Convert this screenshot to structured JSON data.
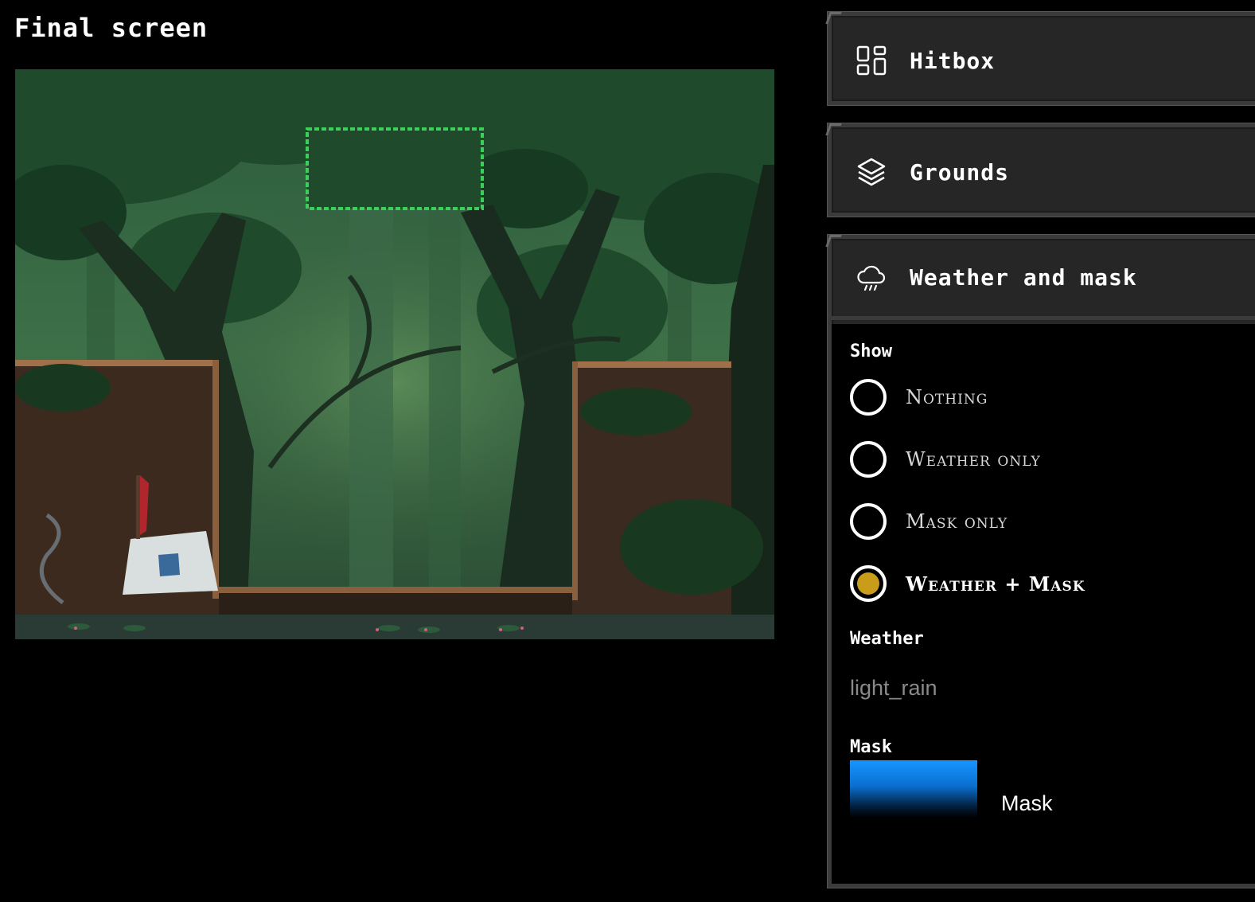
{
  "page_title": "Final screen",
  "panels": {
    "hitbox": {
      "label": "Hitbox",
      "icon": "layout-grid-icon"
    },
    "grounds": {
      "label": "Grounds",
      "icon": "layers-icon"
    },
    "weather": {
      "label": "Weather and mask",
      "icon": "cloud-rain-icon",
      "show_label": "Show",
      "options": [
        {
          "label": "Nothing",
          "selected": false
        },
        {
          "label": "Weather only",
          "selected": false
        },
        {
          "label": "Mask only",
          "selected": false
        },
        {
          "label": "Weather + Mask",
          "selected": true
        }
      ],
      "weather_label": "Weather",
      "weather_value": "light_rain",
      "mask_label": "Mask",
      "mask_file_label": "Mask"
    }
  },
  "colors": {
    "radio_selected": "#c99d1a",
    "hitbox_outline": "#3cd05a",
    "mask_gradient_top": "#1796ff"
  }
}
